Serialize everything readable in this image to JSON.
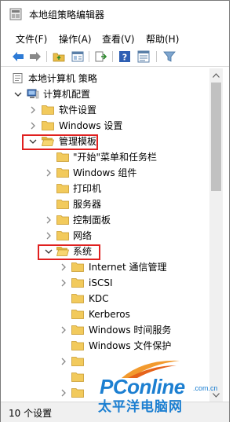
{
  "window": {
    "title": "本地组策略编辑器"
  },
  "menu": [
    {
      "label": "文件(F)"
    },
    {
      "label": "操作(A)"
    },
    {
      "label": "查看(V)"
    },
    {
      "label": "帮助(H)"
    }
  ],
  "toolbar": {
    "icons": [
      "back-arrow-icon",
      "forward-arrow-icon",
      "folder-up-icon",
      "show-hide-tree-icon",
      "export-list-icon",
      "help-icon",
      "properties-icon",
      "filter-icon"
    ]
  },
  "tree": {
    "root": "本地计算机 策略",
    "computer_config": "计算机配置",
    "software_settings": "软件设置",
    "windows_settings": "Windows 设置",
    "admin_templates": "管理模板",
    "start_menu": "\"开始\"菜单和任务栏",
    "windows_components": "Windows 组件",
    "printers": "打印机",
    "server": "服务器",
    "control_panel": "控制面板",
    "network": "网络",
    "system": "系统",
    "internet_comm": "Internet 通信管理",
    "iscsi": "iSCSI",
    "kdc": "KDC",
    "kerberos": "Kerberos",
    "win_time": "Windows 时间服务",
    "win_file_protect": "Windows 文件保护"
  },
  "highlight_color": "#e0201f",
  "status": {
    "text": "10 个设置"
  },
  "watermark": {
    "brand": "PConline",
    "domain": ".com.cn",
    "cn": "太平洋电脑网"
  }
}
